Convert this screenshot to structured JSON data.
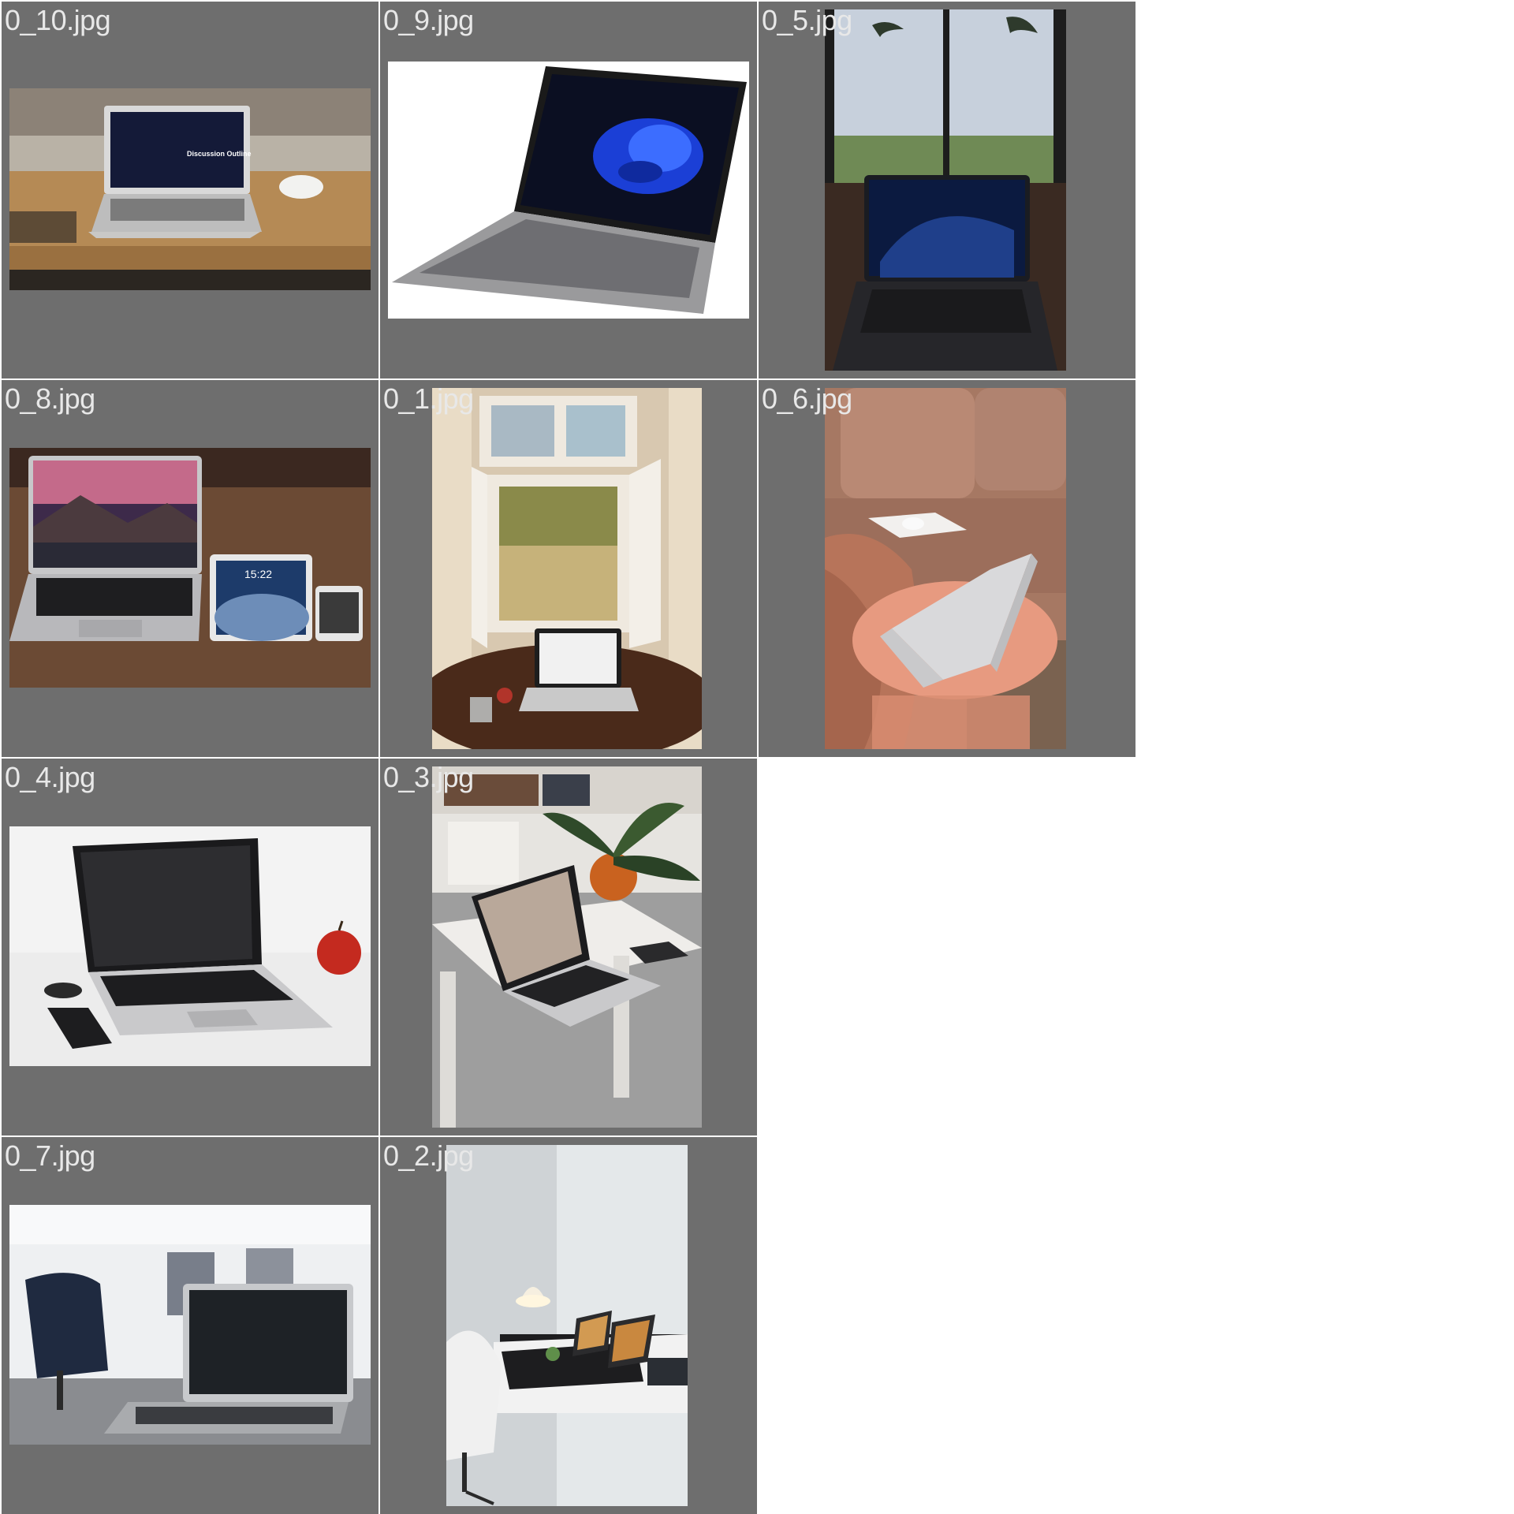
{
  "grid": {
    "cells": [
      {
        "filename": "0_10.jpg",
        "scene": "laptop-on-office-desk",
        "screen_text": "Discussion Outline"
      },
      {
        "filename": "0_9.jpg",
        "scene": "laptop-blue-wallpaper-white-background"
      },
      {
        "filename": "0_5.jpg",
        "scene": "laptop-window-palm-trees"
      },
      {
        "filename": "0_8.jpg",
        "scene": "laptop-tablet-phone-on-wood",
        "tablet_time": "15:22"
      },
      {
        "filename": "0_1.jpg",
        "scene": "laptop-table-open-window"
      },
      {
        "filename": "0_6.jpg",
        "scene": "laptop-pink-side-table-sofa"
      },
      {
        "filename": "0_4.jpg",
        "scene": "laptop-apple-phone-white"
      },
      {
        "filename": "0_3.jpg",
        "scene": "laptop-plant-white-table"
      },
      {
        "filename": "0_7.jpg",
        "scene": "laptop-office-chairs"
      },
      {
        "filename": "0_2.jpg",
        "scene": "white-desk-lamp-two-screens"
      }
    ]
  }
}
